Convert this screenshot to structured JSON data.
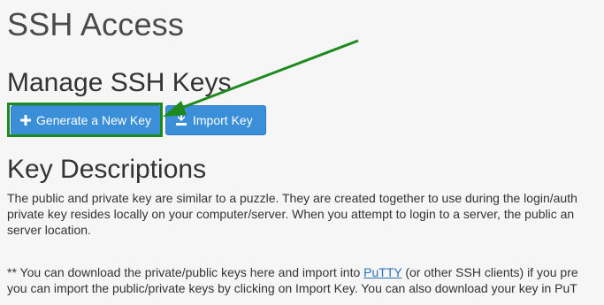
{
  "page": {
    "title": "SSH Access"
  },
  "manage_section": {
    "title": "Manage SSH Keys",
    "generate_button_label": "Generate a New Key",
    "import_button_label": "Import Key"
  },
  "descriptions_section": {
    "title": "Key Descriptions",
    "paragraph_1_lines": [
      "The public and private key are similar to a puzzle. They are created together to use during the login/auth",
      "private key resides locally on your computer/server. When you attempt to login to a server, the public an",
      "server location."
    ],
    "paragraph_2": {
      "line_1_before_link": "** You can download the private/public keys here and import into ",
      "link_text": "PuTTY",
      "line_1_after_link": " (or other SSH clients) if you pre",
      "line_2": "you can import the public/private keys by clicking on Import Key. You can also download your key in PuT"
    }
  },
  "annotation": {
    "highlight_color": "#1e8a1e"
  },
  "icons": {
    "generate": "plus-icon",
    "import": "import-key-icon"
  },
  "colors": {
    "button_bg": "#3b8fd9",
    "button_border": "#2f7cc4",
    "link": "#2a6fb8"
  }
}
